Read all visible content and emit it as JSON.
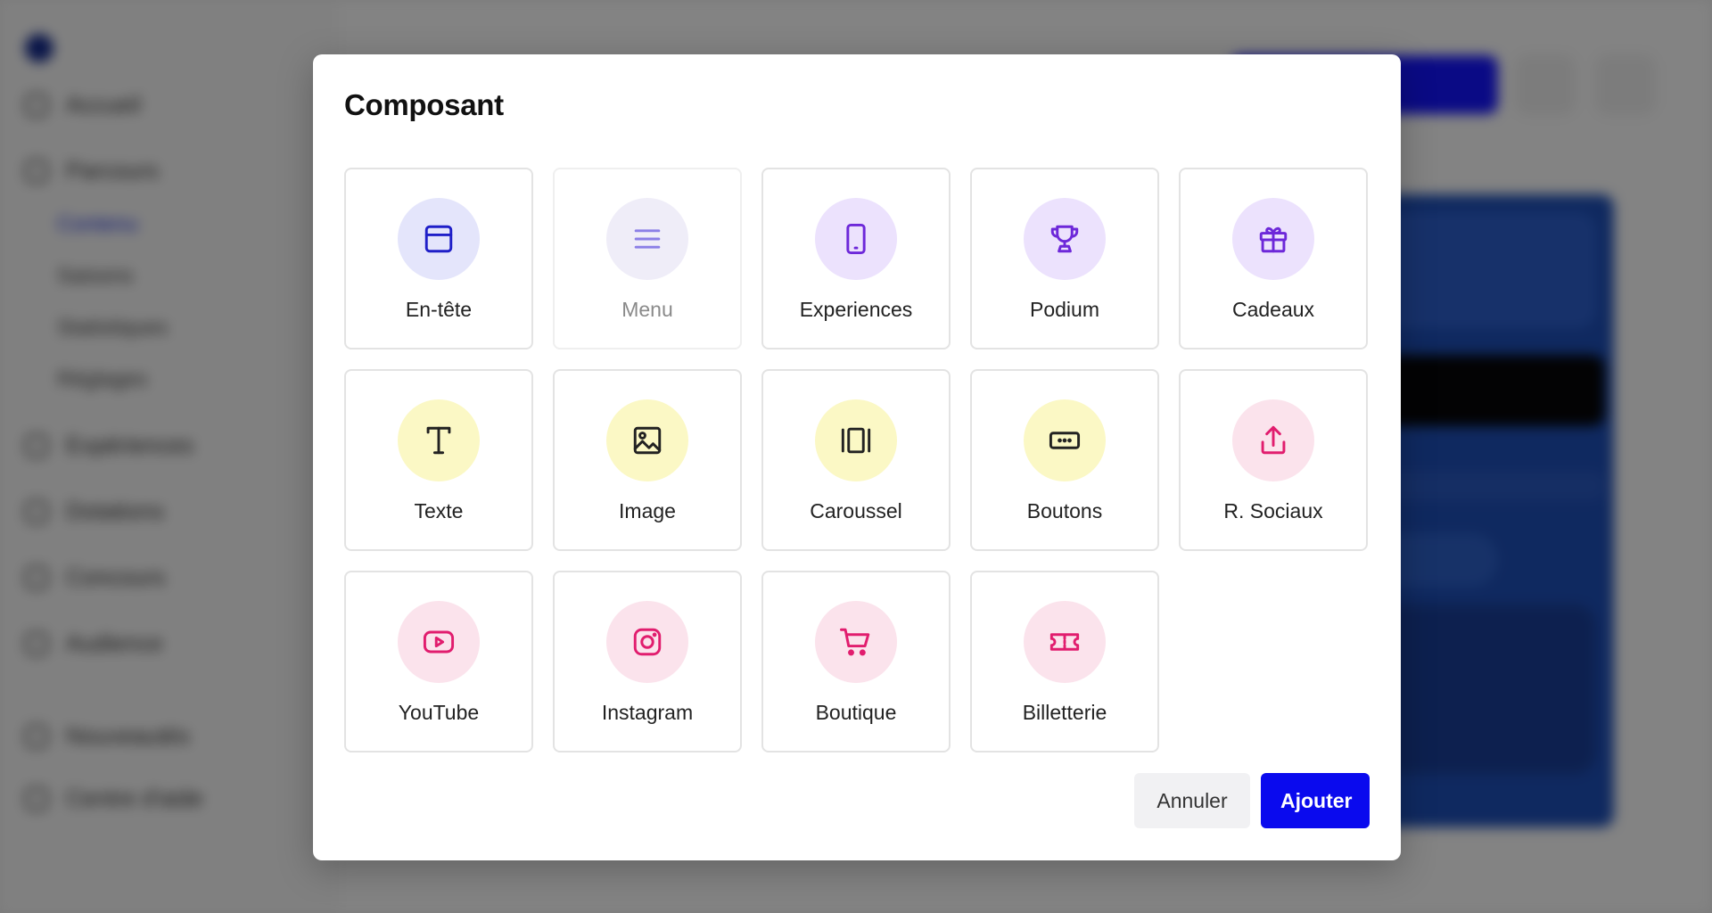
{
  "background": {
    "nav_items": [
      {
        "label": "Accueil"
      },
      {
        "label": "Parcours"
      },
      {
        "label": "Expériences"
      },
      {
        "label": "Dotations"
      },
      {
        "label": "Concours"
      },
      {
        "label": "Audience"
      },
      {
        "label": "Nouveautés"
      },
      {
        "label": "Centre d'aide"
      }
    ],
    "sub_items": [
      {
        "label": "Contenu"
      },
      {
        "label": "Saisons"
      },
      {
        "label": "Statistiques"
      },
      {
        "label": "Réglages"
      }
    ]
  },
  "modal": {
    "title": "Composant",
    "components": [
      {
        "label": "En-tête",
        "icon": "header-icon",
        "color": "#1f1fc8"
      },
      {
        "label": "Menu",
        "icon": "menu-icon",
        "color": "#8b7fe6"
      },
      {
        "label": "Experiences",
        "icon": "tablet-icon",
        "color": "#6d28d9"
      },
      {
        "label": "Podium",
        "icon": "trophy-icon",
        "color": "#6d28d9"
      },
      {
        "label": "Cadeaux",
        "icon": "gift-icon",
        "color": "#6d28d9"
      },
      {
        "label": "Texte",
        "icon": "text-icon",
        "color": "#222222"
      },
      {
        "label": "Image",
        "icon": "image-icon",
        "color": "#222222"
      },
      {
        "label": "Caroussel",
        "icon": "carousel-icon",
        "color": "#222222"
      },
      {
        "label": "Boutons",
        "icon": "button-icon",
        "color": "#222222"
      },
      {
        "label": "R. Sociaux",
        "icon": "share-icon",
        "color": "#e11d6e"
      },
      {
        "label": "YouTube",
        "icon": "youtube-icon",
        "color": "#e11d6e"
      },
      {
        "label": "Instagram",
        "icon": "instagram-icon",
        "color": "#e11d6e"
      },
      {
        "label": "Boutique",
        "icon": "cart-icon",
        "color": "#e11d6e"
      },
      {
        "label": "Billetterie",
        "icon": "ticket-icon",
        "color": "#e11d6e"
      }
    ],
    "cancel_label": "Annuler",
    "add_label": "Ajouter"
  }
}
